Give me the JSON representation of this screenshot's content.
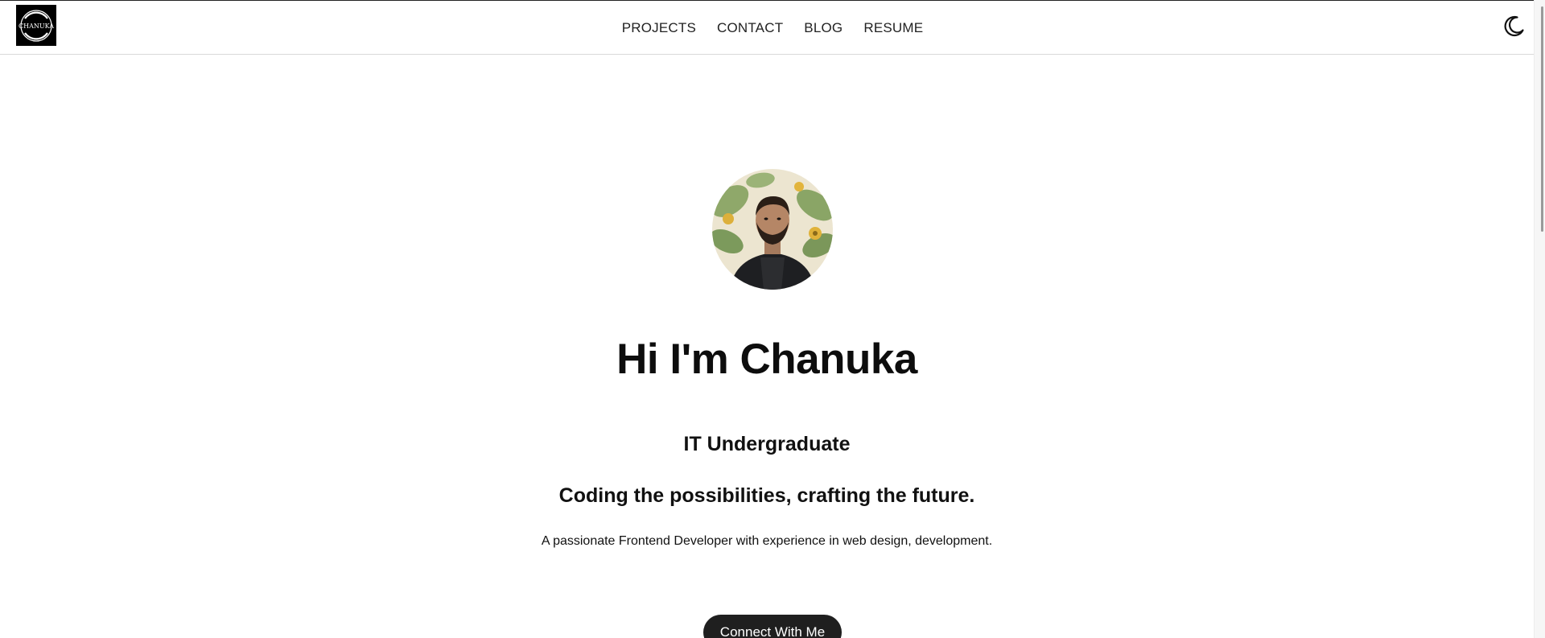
{
  "header": {
    "logo_text": "CHANUKA",
    "nav": [
      {
        "label": "PROJECTS"
      },
      {
        "label": "CONTACT"
      },
      {
        "label": "BLOG"
      },
      {
        "label": "RESUME"
      }
    ],
    "theme_icon": "moon-icon"
  },
  "hero": {
    "avatar_icon": "profile-photo",
    "headline": "Hi I'm Chanuka",
    "role": "IT Undergraduate",
    "tagline": "Coding the possibilities, crafting the future.",
    "description": "A passionate Frontend Developer with experience in web design, development.",
    "cta_label": "Connect With Me"
  },
  "colors": {
    "background": "#ffffff",
    "text": "#111111",
    "button": "#1f1f1f",
    "button_text": "#ffffff"
  }
}
